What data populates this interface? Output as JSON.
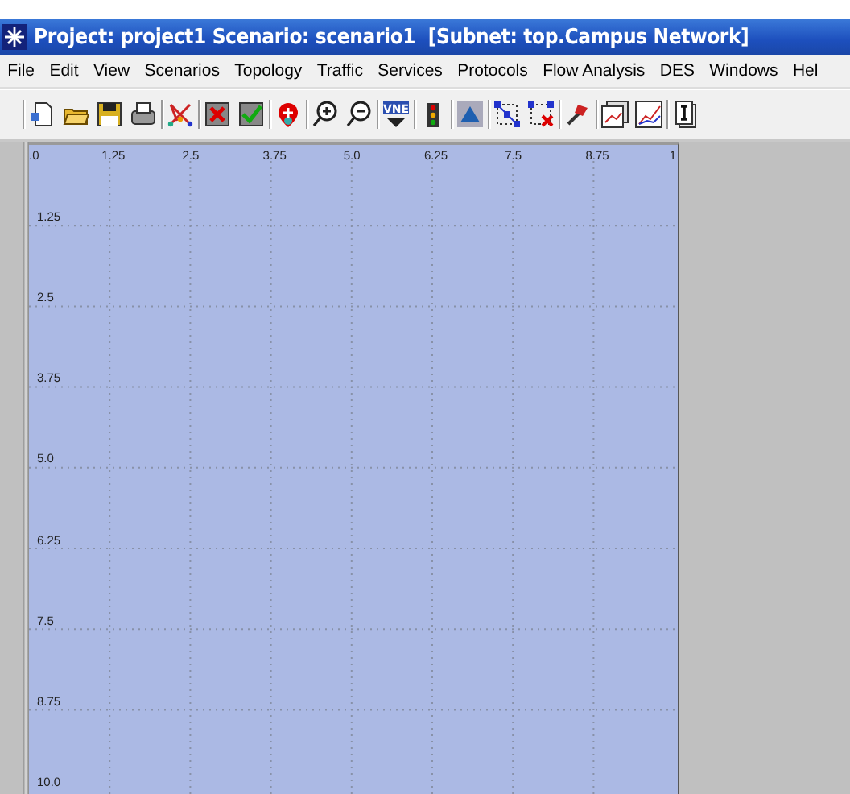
{
  "window": {
    "title": "Project: project1 Scenario: scenario1  [Subnet: top.Campus Network]"
  },
  "menu": [
    "File",
    "Edit",
    "View",
    "Scenarios",
    "Topology",
    "Traffic",
    "Services",
    "Protocols",
    "Flow Analysis",
    "DES",
    "Windows",
    "Hel"
  ],
  "toolbar": [
    [
      {
        "kind": "new-document"
      },
      {
        "kind": "open-folder"
      },
      {
        "kind": "save"
      },
      {
        "kind": "print"
      }
    ],
    [
      {
        "kind": "node-config"
      }
    ],
    [
      {
        "kind": "fail-node"
      },
      {
        "kind": "recover-node"
      }
    ],
    [
      {
        "kind": "location-pin"
      }
    ],
    [
      {
        "kind": "zoom-in"
      },
      {
        "kind": "zoom-out"
      }
    ],
    [
      {
        "kind": "vne",
        "label": "VNE"
      }
    ],
    [
      {
        "kind": "traffic-light"
      }
    ],
    [
      {
        "kind": "triangle"
      }
    ],
    [
      {
        "kind": "network-graph"
      },
      {
        "kind": "network-graph-x"
      }
    ],
    [
      {
        "kind": "hammer"
      }
    ],
    [
      {
        "kind": "stat-window"
      },
      {
        "kind": "line-chart"
      }
    ],
    [
      {
        "kind": "info"
      }
    ]
  ],
  "canvas": {
    "x_labels": [
      ".0",
      "1.25",
      "2.5",
      "3.75",
      "5.0",
      "6.25",
      "7.5",
      "8.75",
      "1"
    ],
    "y_labels": [
      "1.25",
      "2.5",
      "3.75",
      "5.0",
      "6.25",
      "7.5",
      "8.75",
      "10.0"
    ]
  }
}
